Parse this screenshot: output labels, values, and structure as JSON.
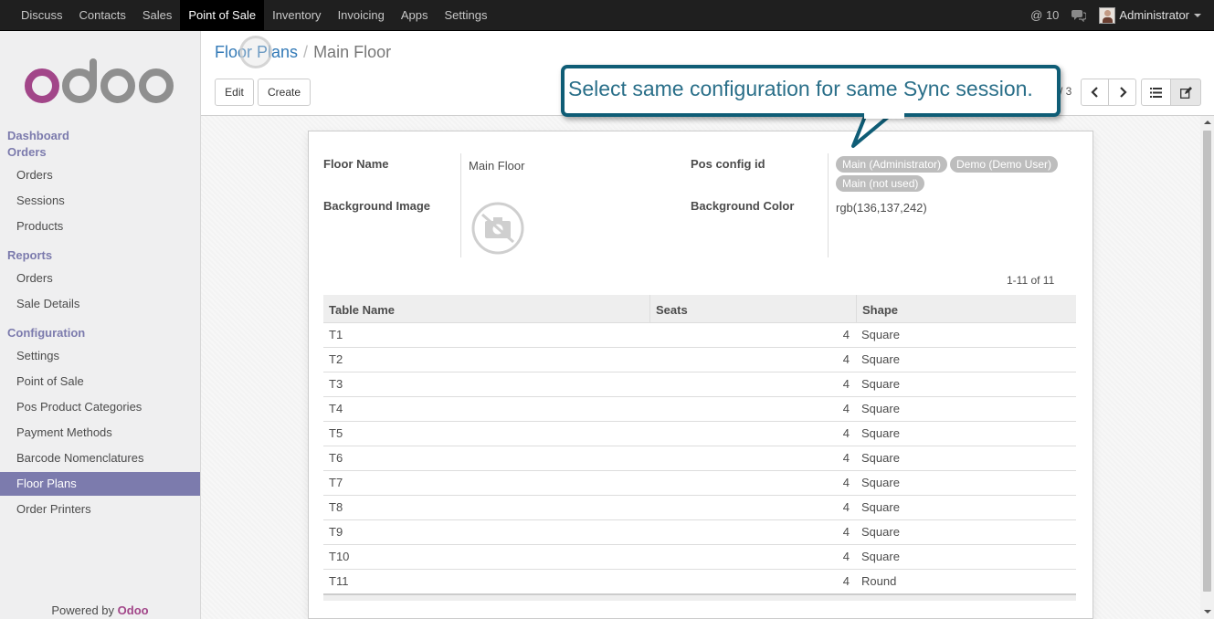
{
  "topnav": {
    "menu": [
      "Discuss",
      "Contacts",
      "Sales",
      "Point of Sale",
      "Inventory",
      "Invoicing",
      "Apps",
      "Settings"
    ],
    "active": "Point of Sale",
    "mentions": "@ 10",
    "user": "Administrator"
  },
  "sidebar": {
    "logo": "odoo",
    "dashboard": "Dashboard",
    "orders_header": "Orders",
    "orders_items": [
      "Orders",
      "Sessions",
      "Products"
    ],
    "reports_header": "Reports",
    "reports_items": [
      "Orders",
      "Sale Details"
    ],
    "config_header": "Configuration",
    "config_items": [
      "Settings",
      "Point of Sale",
      "Pos Product Categories",
      "Payment Methods",
      "Barcode Nomenclatures",
      "Floor Plans",
      "Order Printers"
    ],
    "active_item": "Floor Plans",
    "powered_by": "Powered by",
    "powered_brand": "Odoo"
  },
  "control": {
    "breadcrumb_parent": "Floor Plans",
    "breadcrumb_sep": "/",
    "breadcrumb_current": "Main Floor",
    "edit_label": "Edit",
    "create_label": "Create",
    "pager": "/ 3"
  },
  "form": {
    "floor_name_label": "Floor Name",
    "floor_name_value": "Main Floor",
    "background_image_label": "Background Image",
    "pos_config_label": "Pos config id",
    "pos_config_tags": [
      "Main (Administrator)",
      "Demo (Demo User)",
      "Main (not used)"
    ],
    "background_color_label": "Background Color",
    "background_color_value": "rgb(136,137,242)",
    "table_pager": "1-11 of 11"
  },
  "tables": {
    "headers": [
      "Table Name",
      "Seats",
      "Shape"
    ],
    "rows": [
      [
        "T1",
        "4",
        "Square"
      ],
      [
        "T2",
        "4",
        "Square"
      ],
      [
        "T3",
        "4",
        "Square"
      ],
      [
        "T4",
        "4",
        "Square"
      ],
      [
        "T5",
        "4",
        "Square"
      ],
      [
        "T6",
        "4",
        "Square"
      ],
      [
        "T7",
        "4",
        "Square"
      ],
      [
        "T8",
        "4",
        "Square"
      ],
      [
        "T9",
        "4",
        "Square"
      ],
      [
        "T10",
        "4",
        "Square"
      ],
      [
        "T11",
        "4",
        "Round"
      ]
    ]
  },
  "callout": {
    "text": "Select same configuration for same Sync session."
  },
  "colors": {
    "brand": "#7c7bad",
    "callout_border": "#0f5d76",
    "link": "#337ab7"
  }
}
